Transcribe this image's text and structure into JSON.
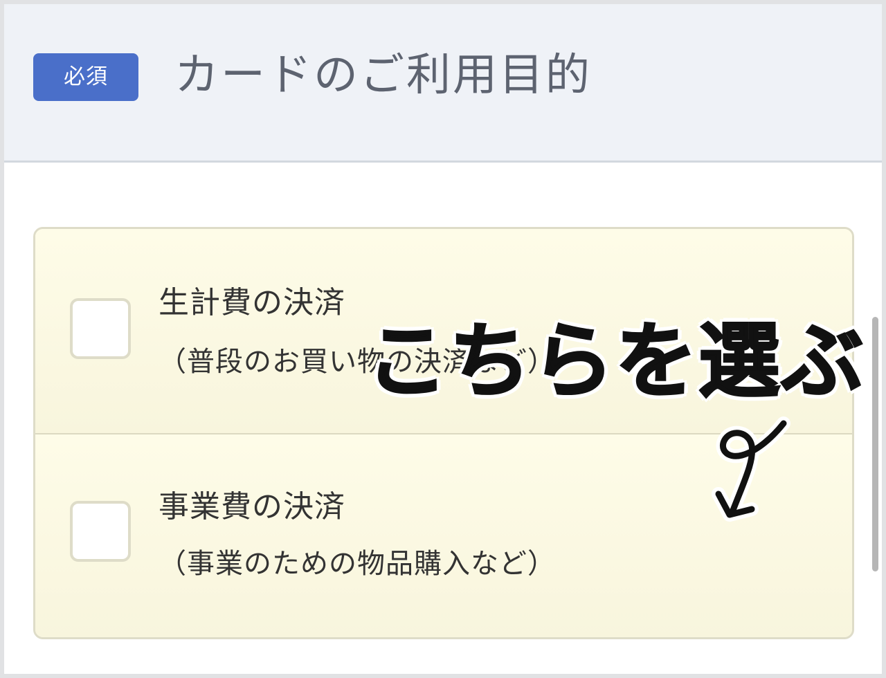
{
  "header": {
    "badge": "必須",
    "title": "カードのご利用目的"
  },
  "options": [
    {
      "label": "生計費の決済",
      "sublabel": "（普段のお買い物の決済など）",
      "checked": false
    },
    {
      "label": "事業費の決済",
      "sublabel": "（事業のための物品購入など）",
      "checked": false
    }
  ],
  "annotation": {
    "text": "こちらを選ぶ",
    "icon": "hand-drawn-loop-arrow-icon"
  },
  "colors": {
    "badge": "#4a6fc9",
    "header_bg": "#eff2f7",
    "options_bg": "#fdfbe6",
    "annotation": "#111111"
  }
}
